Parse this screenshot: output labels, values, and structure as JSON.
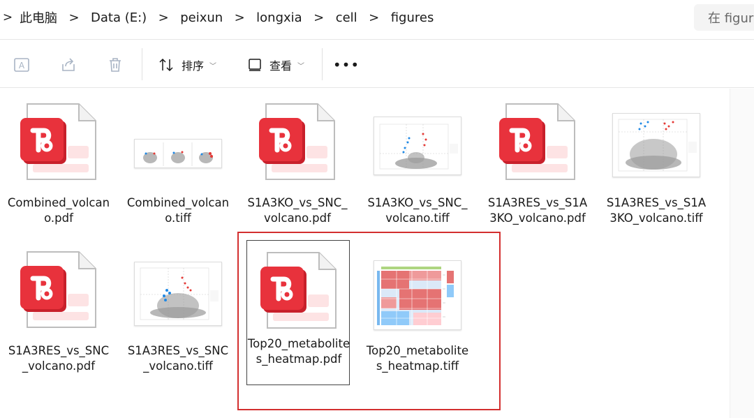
{
  "address_bar": {
    "nav_arrow": ">",
    "separator": ">",
    "crumbs": [
      "此电脑",
      "Data (E:)",
      "peixun",
      "longxia",
      "cell",
      "figures"
    ],
    "search_placeholder": "在 figur"
  },
  "command_bar": {
    "sort_label": "排序",
    "view_label": "查看",
    "more_label": "•••",
    "icons": [
      "rename-icon",
      "share-icon",
      "delete-icon",
      "sort-icon",
      "view-icon",
      "more-icon"
    ]
  },
  "files": [
    {
      "name": "Combined_volcano.pdf",
      "type": "pdf"
    },
    {
      "name": "Combined_volcano.tiff",
      "type": "tiff"
    },
    {
      "name": "S1A3KO_vs_SNC_volcano.pdf",
      "type": "pdf"
    },
    {
      "name": "S1A3KO_vs_SNC_volcano.tiff",
      "type": "tiff"
    },
    {
      "name": "S1A3RES_vs_S1A3KO_volcano.pdf",
      "type": "pdf"
    },
    {
      "name": "S1A3RES_vs_S1A3KO_volcano.tiff",
      "type": "tiff"
    },
    {
      "name": "S1A3RES_vs_SNC_volcano.pdf",
      "type": "pdf"
    },
    {
      "name": "S1A3RES_vs_SNC_volcano.tiff",
      "type": "tiff"
    },
    {
      "name": "Top20_metabolites_heatmap.pdf",
      "type": "pdf",
      "selected": true
    },
    {
      "name": "Top20_metabolites_heatmap.tiff",
      "type": "tiff"
    }
  ],
  "colors": {
    "pdf_red": "#e8323c",
    "pdf_red_dark": "#c8202b",
    "highlight_frame": "#d32f2f",
    "volcano_grey": "#9a9a9a",
    "volcano_red": "#e53935",
    "volcano_blue": "#1e88e5",
    "heatmap_red": "#e57373",
    "heatmap_blue": "#90caf9"
  }
}
